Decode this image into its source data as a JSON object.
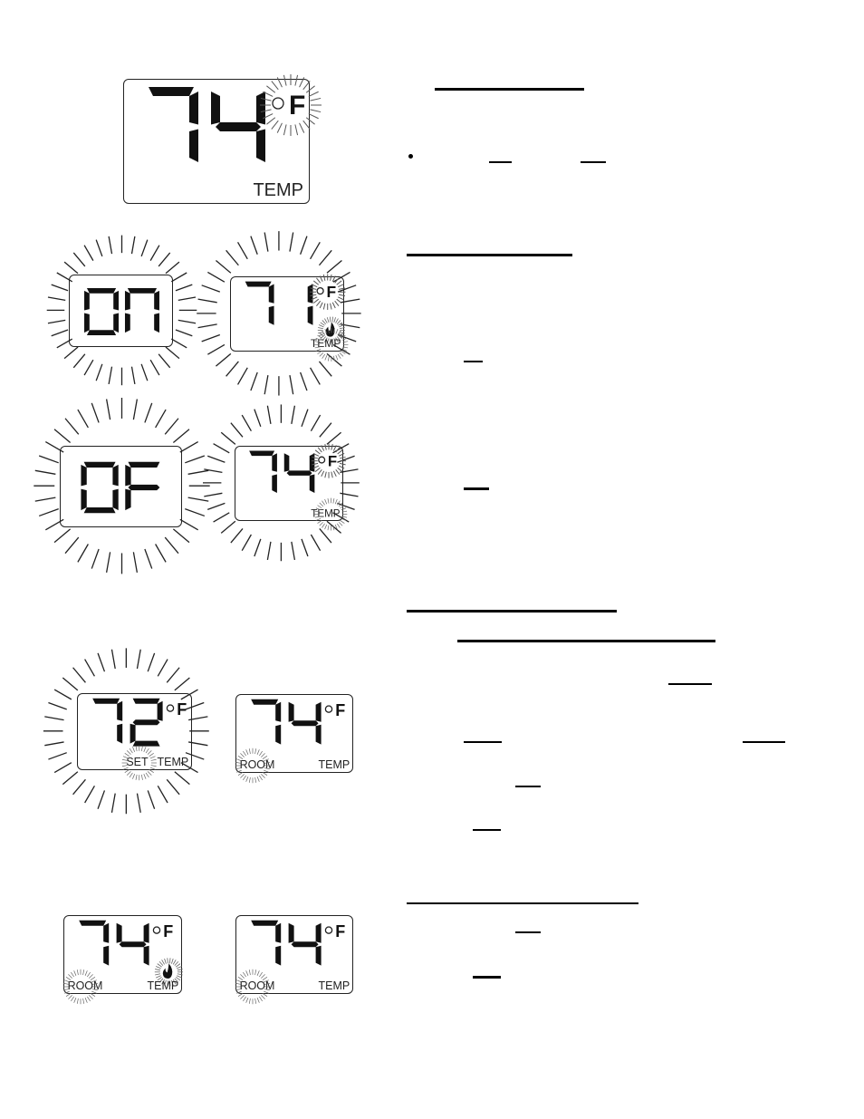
{
  "document": {
    "type": "thermostat-manual-page",
    "figures": [
      {
        "id": "fig-main",
        "digits": "74",
        "unit_symbol": "°",
        "unit": "F",
        "labels": [
          "TEMP"
        ],
        "flashing": [
          "unit"
        ]
      },
      {
        "id": "fig-on",
        "digits": "On",
        "unit_symbol": "",
        "unit": "",
        "labels": [],
        "flashing": [
          "digits"
        ]
      },
      {
        "id": "fig-71",
        "digits": "71",
        "unit_symbol": "°",
        "unit": "F",
        "labels": [
          "TEMP"
        ],
        "icons": [
          "flame-icon"
        ],
        "flashing": [
          "digits",
          "unit",
          "flame",
          "temp-label"
        ]
      },
      {
        "id": "fig-of",
        "digits": "OF",
        "unit_symbol": "",
        "unit": "",
        "labels": [],
        "flashing": [
          "digits"
        ]
      },
      {
        "id": "fig-74-flash",
        "digits": "74",
        "unit_symbol": "°",
        "unit": "F",
        "labels": [
          "TEMP"
        ],
        "flashing": [
          "digits",
          "unit",
          "temp-label"
        ]
      },
      {
        "id": "fig-72-set",
        "digits": "72",
        "unit_symbol": "°",
        "unit": "F",
        "labels": [
          "SET",
          "TEMP"
        ],
        "flashing": [
          "digits",
          "set-label"
        ]
      },
      {
        "id": "fig-74-room",
        "digits": "74",
        "unit_symbol": "°",
        "unit": "F",
        "labels": [
          "ROOM",
          "TEMP"
        ],
        "flashing": [
          "room-label"
        ]
      },
      {
        "id": "fig-74-room-flame",
        "digits": "74",
        "unit_symbol": "°",
        "unit": "F",
        "labels": [
          "ROOM",
          "TEMP"
        ],
        "icons": [
          "flame-icon"
        ],
        "flashing": [
          "room-label",
          "flame"
        ]
      },
      {
        "id": "fig-74-room-2",
        "digits": "74",
        "unit_symbol": "°",
        "unit": "F",
        "labels": [
          "ROOM",
          "TEMP"
        ],
        "flashing": [
          "room-label"
        ]
      }
    ],
    "text_column": {
      "note": "Text content not rendered; only underline marks and one bullet visible",
      "sections": 4,
      "bullets": 1
    }
  }
}
